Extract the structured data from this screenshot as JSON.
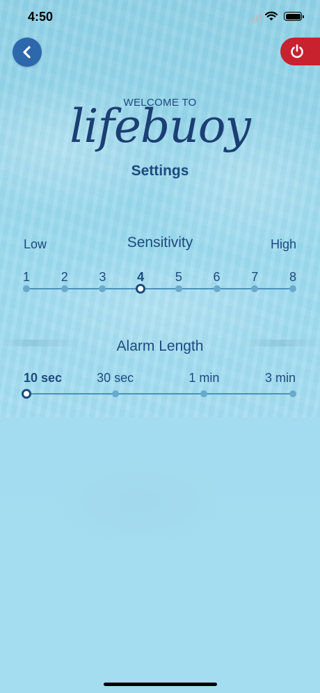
{
  "status_bar": {
    "time": "4:50"
  },
  "header": {
    "welcome": "WELCOME TO",
    "logo": "lifebuoy",
    "title": "Settings"
  },
  "sensitivity": {
    "title": "Sensitivity",
    "low_label": "Low",
    "high_label": "High",
    "levels": [
      "1",
      "2",
      "3",
      "4",
      "5",
      "6",
      "7",
      "8"
    ],
    "selected": "4"
  },
  "alarm_length": {
    "title": "Alarm Length",
    "options": [
      "10 sec",
      "30 sec",
      "1 min",
      "3 min"
    ],
    "selected": "10 sec"
  },
  "colors": {
    "accent": "#1d4a7c",
    "back_button": "#2d68ad",
    "power_button": "#c8222e",
    "background": "#9ad9ee"
  },
  "icons": {
    "back": "chevron-left-icon",
    "power": "power-icon",
    "signal": "cellular-signal-icon",
    "wifi": "wifi-icon",
    "battery": "battery-icon"
  }
}
